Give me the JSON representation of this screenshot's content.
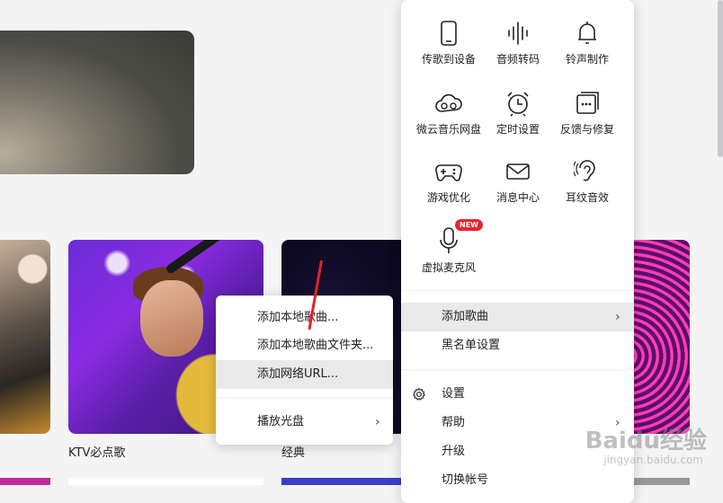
{
  "background": {
    "cards": [
      {
        "title": ""
      },
      {
        "title": "KTV必点歌"
      },
      {
        "title": "经典"
      },
      {
        "title": ""
      }
    ]
  },
  "tools": [
    {
      "label": "传歌到设备",
      "icon": "phone-icon"
    },
    {
      "label": "音频转码",
      "icon": "waveform-icon"
    },
    {
      "label": "铃声制作",
      "icon": "bell-icon"
    },
    {
      "label": "微云音乐网盘",
      "icon": "cloud-icon"
    },
    {
      "label": "定时设置",
      "icon": "alarm-clock-icon"
    },
    {
      "label": "反馈与修复",
      "icon": "feedback-icon"
    },
    {
      "label": "游戏优化",
      "icon": "gamepad-icon"
    },
    {
      "label": "消息中心",
      "icon": "mail-icon"
    },
    {
      "label": "耳纹音效",
      "icon": "ear-icon"
    },
    {
      "label": "虚拟麦克风",
      "icon": "microphone-icon",
      "badge": "NEW"
    }
  ],
  "menu": {
    "add_song": "添加歌曲",
    "blacklist": "黑名单设置",
    "settings": "设置",
    "help": "帮助",
    "upgrade": "升级",
    "switch_account": "切换帐号"
  },
  "submenu": {
    "add_local_song": "添加本地歌曲...",
    "add_local_folder": "添加本地歌曲文件夹...",
    "add_url": "添加网络URL...",
    "play_disc": "播放光盘"
  },
  "watermark": {
    "text": "Baidu经验",
    "sub": "jingyan.baidu.com"
  },
  "colors": {
    "badge": "#e8242e",
    "highlight": "#e9e9ea",
    "arrow": "#e02424"
  }
}
